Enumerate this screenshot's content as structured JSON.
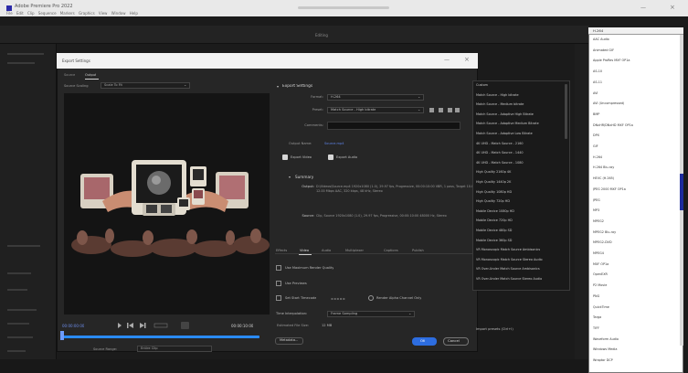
{
  "app": {
    "title": "Adobe Premiere Pro 2022",
    "menu": "File  Edit  Clip  Sequence  Markers  Graphics  View  Window  Help",
    "workspace_tab": "Editing"
  },
  "dialog": {
    "title": "Export Settings",
    "tabs": [
      "Source",
      "Output"
    ],
    "source_scaling_label": "Source Scaling",
    "source_scaling_value": "Scale To Fit",
    "timecode_start": "00:00:00:00",
    "timecode_end": "00:00:10:00",
    "source_range_label": "Source Range:",
    "source_range_value": "Entire Clip",
    "export_settings_heading": "Export Settings",
    "format_label": "Format:",
    "format_value": "H.264",
    "preset_label": "Preset:",
    "preset_value": "Match Source - High bitrate",
    "comments_label": "Comments:",
    "output_name_label": "Output Name:",
    "output_name_value": "Source.mp4",
    "export_video_label": "Export Video",
    "export_audio_label": "Export Audio",
    "summary_heading": "Summary",
    "summary_output_label": "Output:",
    "summary_output_text": "D:\\Videos\\Source.mp4  1920x1080 (1.0), 29.97 fps, Progressive, 00:00:10:00  VBR, 1 pass, Target 10.00 Mbps, Max 12.00 Mbps  AAC, 320 kbps, 48 kHz, Stereo",
    "summary_source_label": "Source:",
    "summary_source_text": "Clip, Source  1920x1080 (1.0), 29.97 fps, Progressive, 00:00:10:00  48000 Hz, Stereo",
    "sub_tabs": [
      "Effects",
      "Video",
      "Audio",
      "Multiplexer",
      "Captions",
      "Publish"
    ],
    "max_render_label": "Use Maximum Render Quality",
    "use_previews_label": "Use Previews",
    "set_start_tc_label": "Set Start Timecode",
    "render_alpha_label": "Render Alpha Channel Only",
    "interpolation_label": "Time Interpolation:",
    "interpolation_value": "Frame Sampling",
    "file_size_label": "Estimated File Size:",
    "file_size_value": "12 MB",
    "metadata_button": "Metadata...",
    "ok_button": "OK",
    "cancel_button": "Cancel"
  },
  "preset_list": {
    "items": [
      "Custom",
      "Match Source - High bitrate",
      "Match Source - Medium bitrate",
      "Match Source - Adaptive High Bitrate",
      "Match Source - Adaptive Medium Bitrate",
      "Match Source - Adaptive Low Bitrate",
      "4K UHD - Match Source - 2160",
      "4K UHD - Match Source - 1440",
      "4K UHD - Match Source - 1080",
      "High Quality 2160p 4K",
      "High Quality 1440p 2K",
      "High Quality 1080p HD",
      "High Quality 720p HD",
      "Mobile Device 1080p HD",
      "Mobile Device 720p HD",
      "Mobile Device 480p SD",
      "Mobile Device 360p SD",
      "VR Monoscopic Match Source Ambisonics",
      "VR Monoscopic Match Source Stereo Audio",
      "VR Over-Under Match Source Ambisonics",
      "VR Over-Under Match Source Stereo Audio"
    ],
    "import_label": "Import presets (Ctrl+I)"
  },
  "format_list": {
    "selected": "H.264",
    "items": [
      "AAC Audio",
      "Animated GIF",
      "Apple ProRes MXF OP1a",
      "AS-10",
      "AS-11",
      "AVI",
      "AVI (Uncompressed)",
      "BMP",
      "DNxHR/DNxHD MXF OP1a",
      "DPX",
      "GIF",
      "H.264",
      "H.264 Blu-ray",
      "HEVC (H.265)",
      "JPEG 2000 MXF OP1a",
      "JPEG",
      "MP3",
      "MPEG2",
      "MPEG2 Blu-ray",
      "MPEG2-DVD",
      "MPEG4",
      "MXF OP1a",
      "OpenEXR",
      "P2 Movie",
      "PNG",
      "QuickTime",
      "Targa",
      "TIFF",
      "Waveform Audio",
      "Windows Media",
      "Wraptor DCP"
    ]
  },
  "colors": {
    "accent_blue": "#2d6de0",
    "timecode_blue": "#6b8ae6",
    "scrollbar_navy": "#1d2b9c"
  }
}
